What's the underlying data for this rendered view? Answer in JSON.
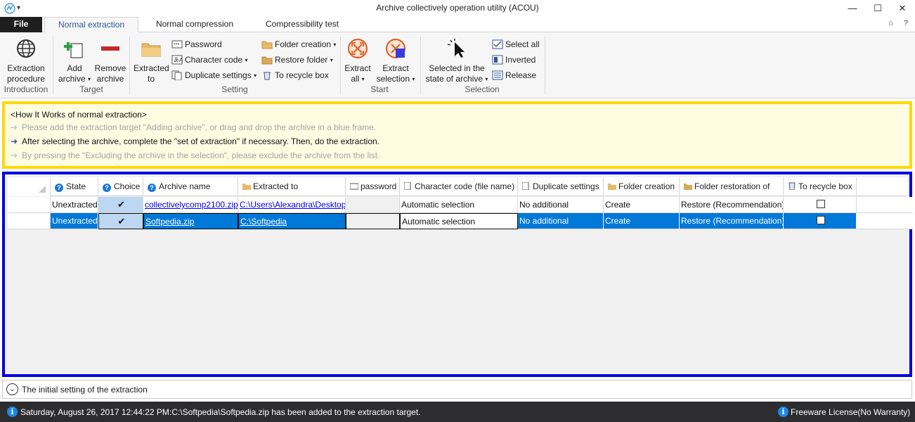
{
  "window": {
    "title": "Archive collectively operation utility (ACOU)",
    "minimize": "—",
    "maximize": "☐",
    "close": "✕"
  },
  "tabs": {
    "file": "File",
    "normal_extraction": "Normal extraction",
    "normal_compression": "Normal compression",
    "compressibility_test": "Compressibility test",
    "collapse_icon": "⌂",
    "help_icon": "?"
  },
  "ribbon": {
    "extraction_procedure": [
      "Extraction",
      "procedure"
    ],
    "introduction_group": "Introduction",
    "add_archive": [
      "Add",
      "archive"
    ],
    "remove_archive": [
      "Remove",
      "archive"
    ],
    "target_group": "Target",
    "extracted_to": [
      "Extracted",
      "to"
    ],
    "password": "Password",
    "character_code": "Character code",
    "duplicate_settings": "Duplicate settings",
    "folder_creation": "Folder creation",
    "restore_folder": "Restore folder",
    "to_recycle_box": "To recycle box",
    "setting_group": "Setting",
    "extract_all": [
      "Extract",
      "all"
    ],
    "extract_selection": [
      "Extract",
      "selection"
    ],
    "start_group": "Start",
    "selected_in_state": [
      "Selected in the",
      "state of archive"
    ],
    "select_all": "Select all",
    "inverted": "Inverted",
    "release": "Release",
    "selection_group": "Selection"
  },
  "info": {
    "heading": "<How It Works of normal extraction>",
    "steps": [
      "Please add the extraction target \"Adding archive\", or drag and drop the archive in a blue frame.",
      "After selecting the archive, complete the \"set of extraction\" if necessary. Then, do the extraction.",
      "By pressing the \"Excluding the archive in the selection\", please exclude the archive from the list."
    ],
    "arrow": "➔"
  },
  "grid": {
    "columns": [
      "State",
      "Choice",
      "Archive name",
      "Extracted to",
      "password",
      "Character code (file name)",
      "Duplicate settings",
      "Folder creation",
      "Folder restoration of",
      "To recycle box"
    ],
    "rows": [
      {
        "state": "Unextracted",
        "choice": "✔",
        "archive": "collectivelycomp2100.zip",
        "extracted_to": "C:\\Users\\Alexandra\\Desktop",
        "password": "",
        "charcode": "Automatic selection",
        "duplicate": "No additional",
        "folder_creation": "Create",
        "restoration": "Restore (Recommendation)",
        "recycle_checked": false
      },
      {
        "state": "Unextracted",
        "choice": "✔",
        "archive": "Softpedia.zip",
        "extracted_to": "C:\\Softpedia",
        "password": "",
        "charcode": "Automatic selection",
        "duplicate": "No additional",
        "folder_creation": "Create",
        "restoration": "Restore (Recommendation)",
        "recycle_checked": false,
        "selected": true
      }
    ]
  },
  "initial_setting": {
    "label": "The initial setting of the extraction",
    "expander": "⌄"
  },
  "status": {
    "message": "Saturday, August 26, 2017 12:44:22 PM:C:\\Softpedia\\Softpedia.zip has been added to the extraction target.",
    "license": "Freeware License(No Warranty)",
    "info_icon": "i"
  },
  "colors": {
    "info_border": "#ffd800",
    "grid_border": "#0000e0",
    "selection": "#0078d7",
    "status_bg": "#2d2d30",
    "accent": "#2b5797"
  }
}
